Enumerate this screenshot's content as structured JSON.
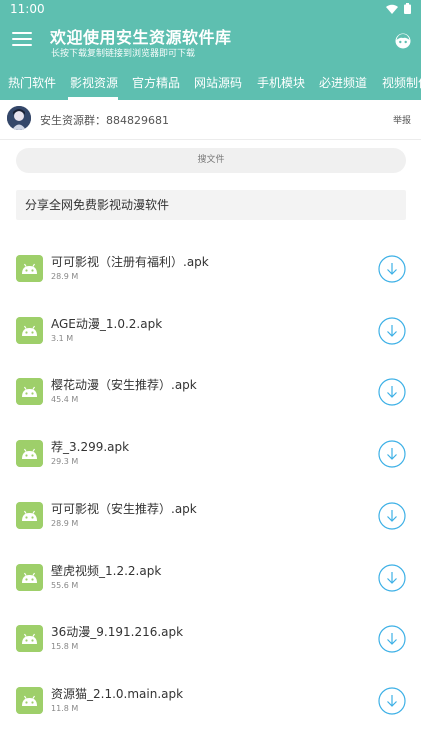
{
  "status_bar": {
    "time": "11:00"
  },
  "header": {
    "title": "欢迎使用安生资源软件库",
    "subtitle": "长按下载复制链接到浏览器即可下载"
  },
  "tabs": [
    {
      "label": "热门软件",
      "selected": false
    },
    {
      "label": "影视资源",
      "selected": true
    },
    {
      "label": "官方精品",
      "selected": false
    },
    {
      "label": "网站源码",
      "selected": false
    },
    {
      "label": "手机模块",
      "selected": false
    },
    {
      "label": "必进频道",
      "selected": false
    },
    {
      "label": "视频制作",
      "selected": false
    }
  ],
  "group": {
    "text": "安生资源群：884829681",
    "report_label": "举报"
  },
  "search": {
    "label": "搜文件"
  },
  "notice": {
    "text": "分享全网免费影视动漫软件"
  },
  "files": [
    {
      "name": "可可影视（注册有福利）.apk",
      "size": "28.9 M"
    },
    {
      "name": "AGE动漫_1.0.2.apk",
      "size": "3.1 M"
    },
    {
      "name": "樱花动漫（安生推荐）.apk",
      "size": "45.4 M"
    },
    {
      "name": "荐_3.299.apk",
      "size": "29.3 M"
    },
    {
      "name": "可可影视（安生推荐）.apk",
      "size": "28.9 M"
    },
    {
      "name": "壁虎视频_1.2.2.apk",
      "size": "55.6 M"
    },
    {
      "name": "36动漫_9.191.216.apk",
      "size": "15.8 M"
    },
    {
      "name": "资源猫_2.1.0.main.apk",
      "size": "11.8 M"
    }
  ],
  "colors": {
    "primary": "#5ebfb0",
    "file_icon": "#9ecf6a",
    "download": "#3db0e6"
  },
  "icons": {
    "menu": "menu-icon",
    "profile": "face-icon",
    "file": "android-icon",
    "download": "download-icon"
  }
}
